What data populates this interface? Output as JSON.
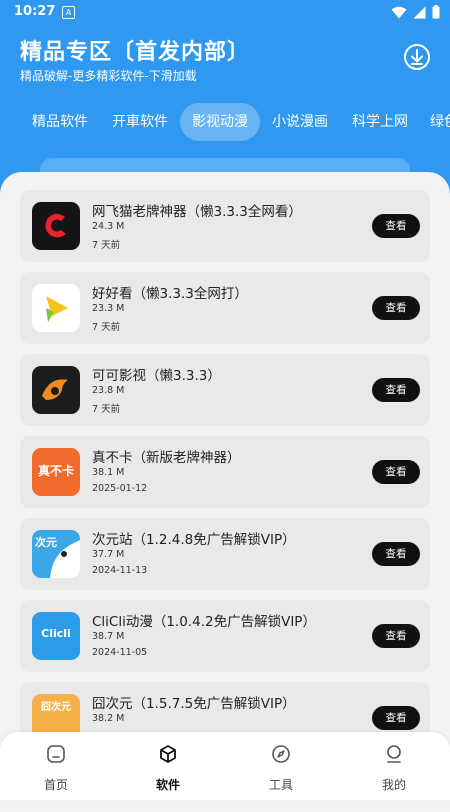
{
  "status_bar": {
    "time": "10:27",
    "app_icon": "A"
  },
  "header": {
    "title": "精品专区〔首发内部〕",
    "subtitle": "精品破解-更多精彩软件-下滑加载",
    "download_icon": "download-circle-icon",
    "color": "#2f98f0"
  },
  "tabs": [
    {
      "label": "精品软件",
      "active": false
    },
    {
      "label": "开車软件",
      "active": false
    },
    {
      "label": "影视动漫",
      "active": true
    },
    {
      "label": "小说漫画",
      "active": false
    },
    {
      "label": "科学上网",
      "active": false
    },
    {
      "label": "绿色",
      "active": false
    }
  ],
  "apps": [
    {
      "name": "网飞猫老牌神器（懒3.3.3全网看）",
      "size": "24.3 M",
      "date": "7 天前",
      "button": "查看"
    },
    {
      "name": "好好看（懒3.3.3全网打）",
      "size": "23.3 M",
      "date": "7 天前",
      "button": "查看"
    },
    {
      "name": "可可影视（懒3.3.3）",
      "size": "23.8 M",
      "date": "7 天前",
      "button": "查看"
    },
    {
      "name": "真不卡（新版老牌神器）",
      "size": "38.1 M",
      "date": "2025-01-12",
      "button": "查看",
      "icon_text": "真不卡"
    },
    {
      "name": "次元站（1.2.4.8免广告解锁VIP）",
      "size": "37.7 M",
      "date": "2024-11-13",
      "button": "查看",
      "icon_text": "次元"
    },
    {
      "name": "CliCli动漫（1.0.4.2免广告解锁VIP）",
      "size": "38.7 M",
      "date": "2024-11-05",
      "button": "查看",
      "icon_text": "Clicli"
    },
    {
      "name": "囧次元（1.5.7.5免广告解锁VIP）",
      "size": "38.2 M",
      "date": "",
      "button": "查看",
      "icon_text": "囧次元"
    }
  ],
  "bottom_nav": [
    {
      "label": "首页",
      "icon": "home-icon",
      "active": false
    },
    {
      "label": "软件",
      "icon": "box-icon",
      "active": true
    },
    {
      "label": "工具",
      "icon": "compass-icon",
      "active": false
    },
    {
      "label": "我的",
      "icon": "user-icon",
      "active": false
    }
  ]
}
